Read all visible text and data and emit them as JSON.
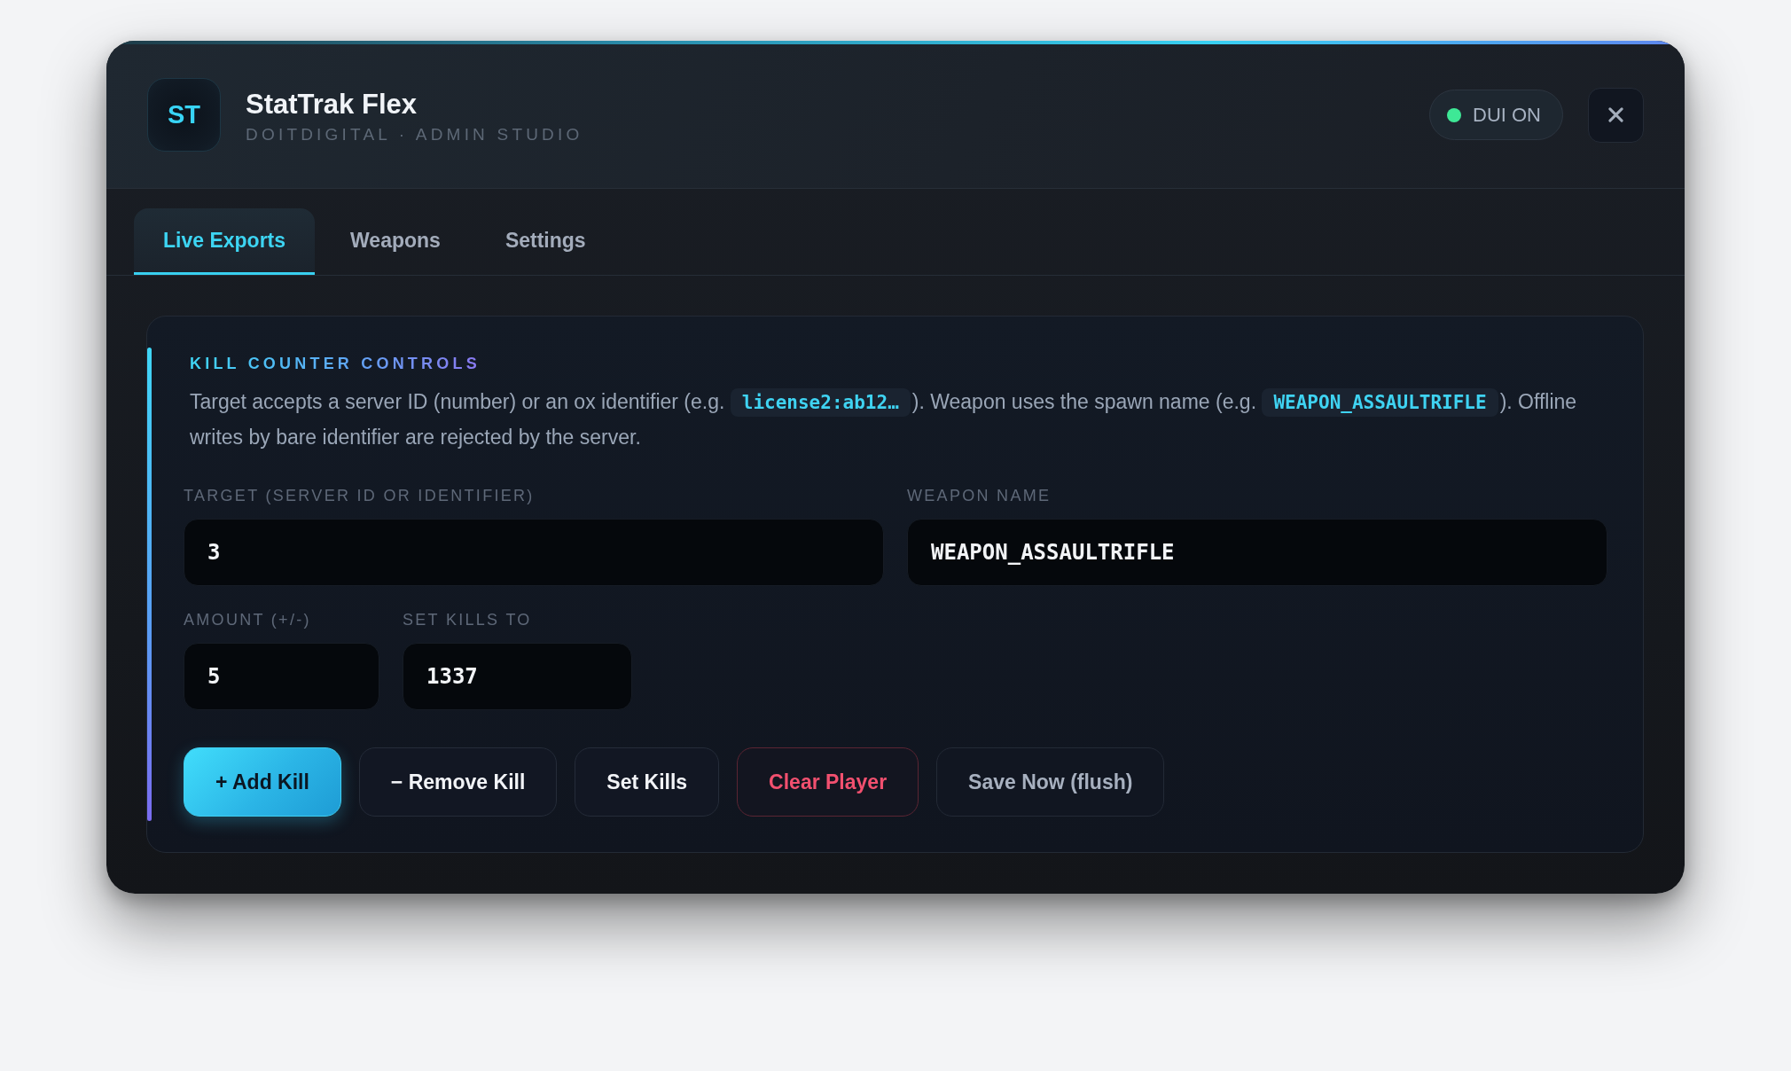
{
  "window": {
    "logo": "ST",
    "title": "StatTrak Flex",
    "subtitle": "DOITDIGITAL · ADMIN STUDIO"
  },
  "status": {
    "label": "DUI ON",
    "active": true
  },
  "tabs": [
    {
      "label": "Live Exports",
      "selected": true
    },
    {
      "label": "Weapons",
      "selected": false
    },
    {
      "label": "Settings",
      "selected": false
    }
  ],
  "section": {
    "title": "KILL COUNTER CONTROLS",
    "description": [
      {
        "kind": "text",
        "text": "Target accepts a server ID (number) or an ox identifier (e.g. "
      },
      {
        "kind": "code",
        "text": "license2:ab12…"
      },
      {
        "kind": "text",
        "text": "). Weapon uses the spawn name (e.g. "
      },
      {
        "kind": "code",
        "text": "WEAPON_ASSAULTRIFLE"
      },
      {
        "kind": "text",
        "text": "). Offline writes by bare identifier are rejected by the server."
      }
    ],
    "field_rows": [
      {
        "kind": "split",
        "fields": [
          {
            "label": "TARGET (SERVER ID OR IDENTIFIER)",
            "value": "3"
          },
          {
            "label": "WEAPON NAME",
            "value": "WEAPON_ASSAULTRIFLE"
          }
        ]
      },
      {
        "kind": "compact",
        "fields": [
          {
            "label": "AMOUNT (+/-)",
            "value": "5"
          },
          {
            "label": "SET KILLS TO",
            "value": "1337"
          }
        ]
      }
    ],
    "buttons": [
      {
        "label": "+ Add Kill",
        "kind": "primary"
      },
      {
        "label": "− Remove Kill",
        "kind": "secondary"
      },
      {
        "label": "Set Kills",
        "kind": "secondary"
      },
      {
        "label": "Clear Player",
        "kind": "danger"
      },
      {
        "label": "Save Now (flush)",
        "kind": "muted"
      }
    ]
  }
}
